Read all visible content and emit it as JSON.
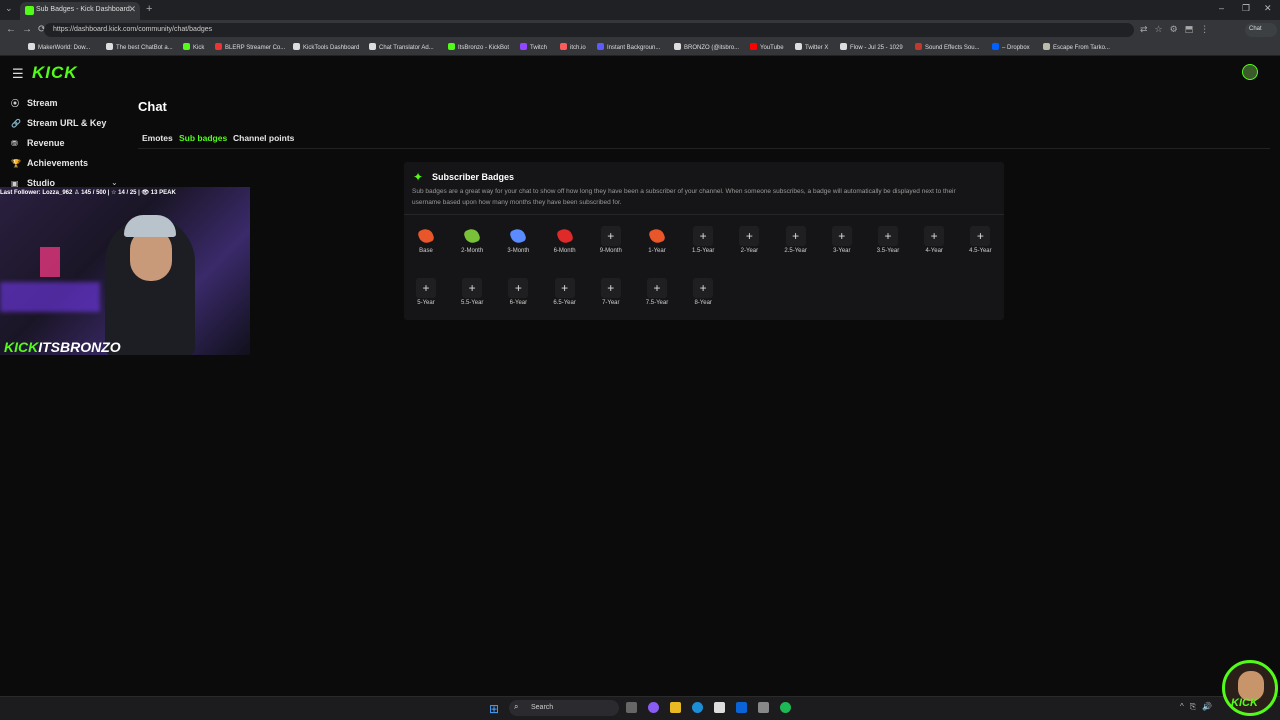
{
  "browser": {
    "tab_title": "Sub Badges - Kick Dashboard",
    "tab_close": "✕",
    "new_tab": "+",
    "url": "https://dashboard.kick.com/community/chat/badges",
    "chat_button": "Chat",
    "window_controls": [
      "–",
      "❐",
      "✕"
    ],
    "bookmarks": [
      {
        "label": "MakerWorld: Dow...",
        "color": "#ddd"
      },
      {
        "label": "The best ChatBot a...",
        "color": "#ddd"
      },
      {
        "label": "Kick",
        "color": "#53fc18"
      },
      {
        "label": "BLERP Streamer Co...",
        "color": "#e33"
      },
      {
        "label": "KickTools Dashboard",
        "color": "#ddd"
      },
      {
        "label": "Chat Translator Ad...",
        "color": "#ddd"
      },
      {
        "label": "ItsBronzo - KickBot",
        "color": "#53fc18"
      },
      {
        "label": "Twitch",
        "color": "#9146ff"
      },
      {
        "label": "itch.io",
        "color": "#fa5c5c"
      },
      {
        "label": "Instant Backgroun...",
        "color": "#5b5bff"
      },
      {
        "label": "BRONZO (@itsbro...",
        "color": "#ddd"
      },
      {
        "label": "YouTube",
        "color": "#ff0000"
      },
      {
        "label": "Twitter X",
        "color": "#ddd"
      },
      {
        "label": "Flow - Jul 25 - 1029",
        "color": "#ddd"
      },
      {
        "label": "Sound Effects Sou...",
        "color": "#c0392b"
      },
      {
        "label": "– Dropbox",
        "color": "#0061fe"
      },
      {
        "label": "Escape From Tarko...",
        "color": "#bba"
      }
    ]
  },
  "app": {
    "logo": "KICK",
    "sidebar": [
      {
        "label": "Stream",
        "icon": "⦿"
      },
      {
        "label": "Stream URL & Key",
        "icon": "🔗"
      },
      {
        "label": "Revenue",
        "icon": "⛃"
      },
      {
        "label": "Achievements",
        "icon": "🏆"
      },
      {
        "label": "Studio",
        "icon": "▣"
      }
    ],
    "page_title": "Chat",
    "tabs": [
      "Emotes",
      "Sub badges",
      "Channel points"
    ],
    "active_tab": "Sub badges",
    "panel": {
      "title": "Subscriber Badges",
      "description": "Sub badges are a great way for your chat to show off how long they have been a subscriber of your channel. When someone subscribes, a badge will automatically be displayed next to their username based upon how many months they have been subscribed for.",
      "badges": [
        {
          "label": "Base",
          "filled": true,
          "color": "#e8562a"
        },
        {
          "label": "2-Month",
          "filled": true,
          "color": "#7ac13a"
        },
        {
          "label": "3-Month",
          "filled": true,
          "color": "#5a8cff"
        },
        {
          "label": "6-Month",
          "filled": true,
          "color": "#e02a2a"
        },
        {
          "label": "9-Month",
          "filled": false
        },
        {
          "label": "1-Year",
          "filled": true,
          "color": "#e8562a"
        },
        {
          "label": "1.5-Year",
          "filled": false
        },
        {
          "label": "2-Year",
          "filled": false
        },
        {
          "label": "2.5-Year",
          "filled": false
        },
        {
          "label": "3-Year",
          "filled": false
        },
        {
          "label": "3.5-Year",
          "filled": false
        },
        {
          "label": "4-Year",
          "filled": false
        },
        {
          "label": "4.5-Year",
          "filled": false
        },
        {
          "label": "5-Year",
          "filled": false
        },
        {
          "label": "5.5-Year",
          "filled": false
        },
        {
          "label": "6-Year",
          "filled": false
        },
        {
          "label": "6.5-Year",
          "filled": false
        },
        {
          "label": "7-Year",
          "filled": false
        },
        {
          "label": "7.5-Year",
          "filled": false
        },
        {
          "label": "8-Year",
          "filled": false
        }
      ],
      "add_glyph": "+"
    }
  },
  "webcam": {
    "overlay": "Last Follower: Lozza_962   ♙ 145 / 500  |  ☆ 14 / 25  |  👁 13 PEAK",
    "brand_k": "KICK",
    "brand_name": "ITSBRONZO"
  },
  "taskbar": {
    "search": "Search"
  },
  "colors": {
    "accent": "#53fc18",
    "panel": "#151517",
    "bg": "#0b0b0c"
  }
}
